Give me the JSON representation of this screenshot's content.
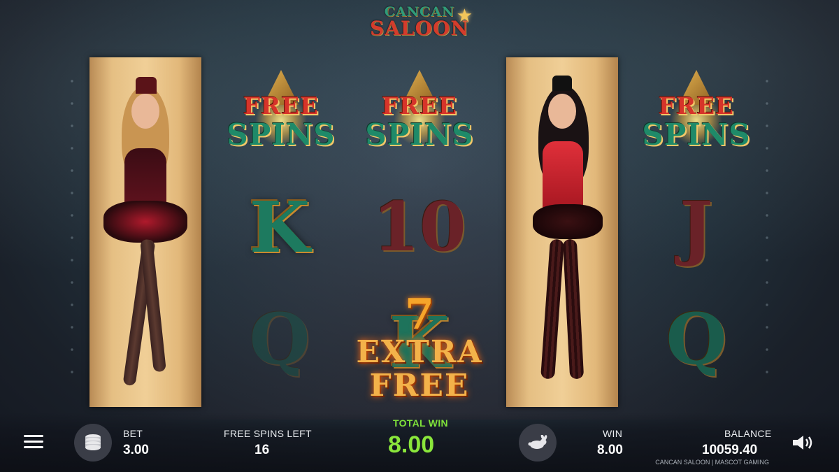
{
  "logo": {
    "line1": "CANCAN",
    "line2": "SALOON"
  },
  "reels": {
    "free_spins_top": "FREE",
    "free_spins_bottom": "SPINS",
    "symbols": {
      "reel2_row2": "K",
      "reel3_row2": "10",
      "reel5_row2": "J",
      "reel2_row3": "Q",
      "reel3_row3": "K",
      "reel5_row3": "Q"
    }
  },
  "promo": {
    "number": "7",
    "text": "EXTRA FREE"
  },
  "footer": {
    "bet_label": "BET",
    "bet_value": "3.00",
    "free_spins_left_label": "FREE SPINS LEFT",
    "free_spins_left_value": "16",
    "total_win_label": "TOTAL WIN",
    "total_win_value": "8.00",
    "win_label": "WIN",
    "win_value": "8.00",
    "balance_label": "BALANCE",
    "balance_value": "10059.40",
    "credit": "CANCAN SALOON | MASCOT GAMING"
  },
  "icons": {
    "menu": "menu-icon",
    "coins": "coins-icon",
    "turbo": "rabbit-icon",
    "sound": "speaker-icon"
  },
  "colors": {
    "total_win": "#8ae63b",
    "promo": "#f3b24a",
    "free_red": "#d6342a",
    "spins_green": "#1f8a69"
  }
}
